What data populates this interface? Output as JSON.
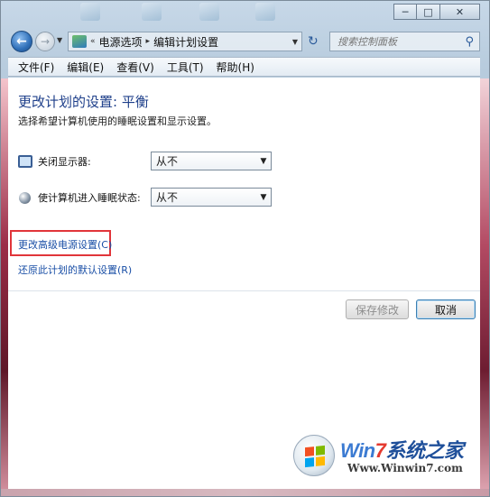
{
  "window": {
    "caption_buttons": {
      "minimize": "─",
      "maximize": "□",
      "close": "✕"
    }
  },
  "address": {
    "crumbs": [
      "电源选项",
      "编辑计划设置"
    ],
    "separator": "▸",
    "overflow": "«",
    "refresh_icon": "refresh-icon",
    "search_placeholder": "搜索控制面板"
  },
  "menubar": {
    "items": [
      "文件(F)",
      "编辑(E)",
      "查看(V)",
      "工具(T)",
      "帮助(H)"
    ]
  },
  "main": {
    "title": "更改计划的设置: 平衡",
    "subtitle": "选择希望计算机使用的睡眠设置和显示设置。",
    "settings": [
      {
        "label": "关闭显示器:",
        "value": "从不",
        "icon": "monitor-icon"
      },
      {
        "label": "使计算机进入睡眠状态:",
        "value": "从不",
        "icon": "moon-icon"
      }
    ],
    "links": {
      "advanced": "更改高级电源设置(C)",
      "restore": "还原此计划的默认设置(R)"
    },
    "buttons": {
      "save": "保存修改",
      "cancel": "取消"
    }
  },
  "watermark": {
    "brand_win": "Win",
    "brand_seven": "7",
    "brand_rest": "系统之家",
    "url": "Www.Winwin7.com"
  },
  "colors": {
    "title": "#1e3f8a",
    "link": "#1a4fa6",
    "highlight": "#e1353a"
  }
}
